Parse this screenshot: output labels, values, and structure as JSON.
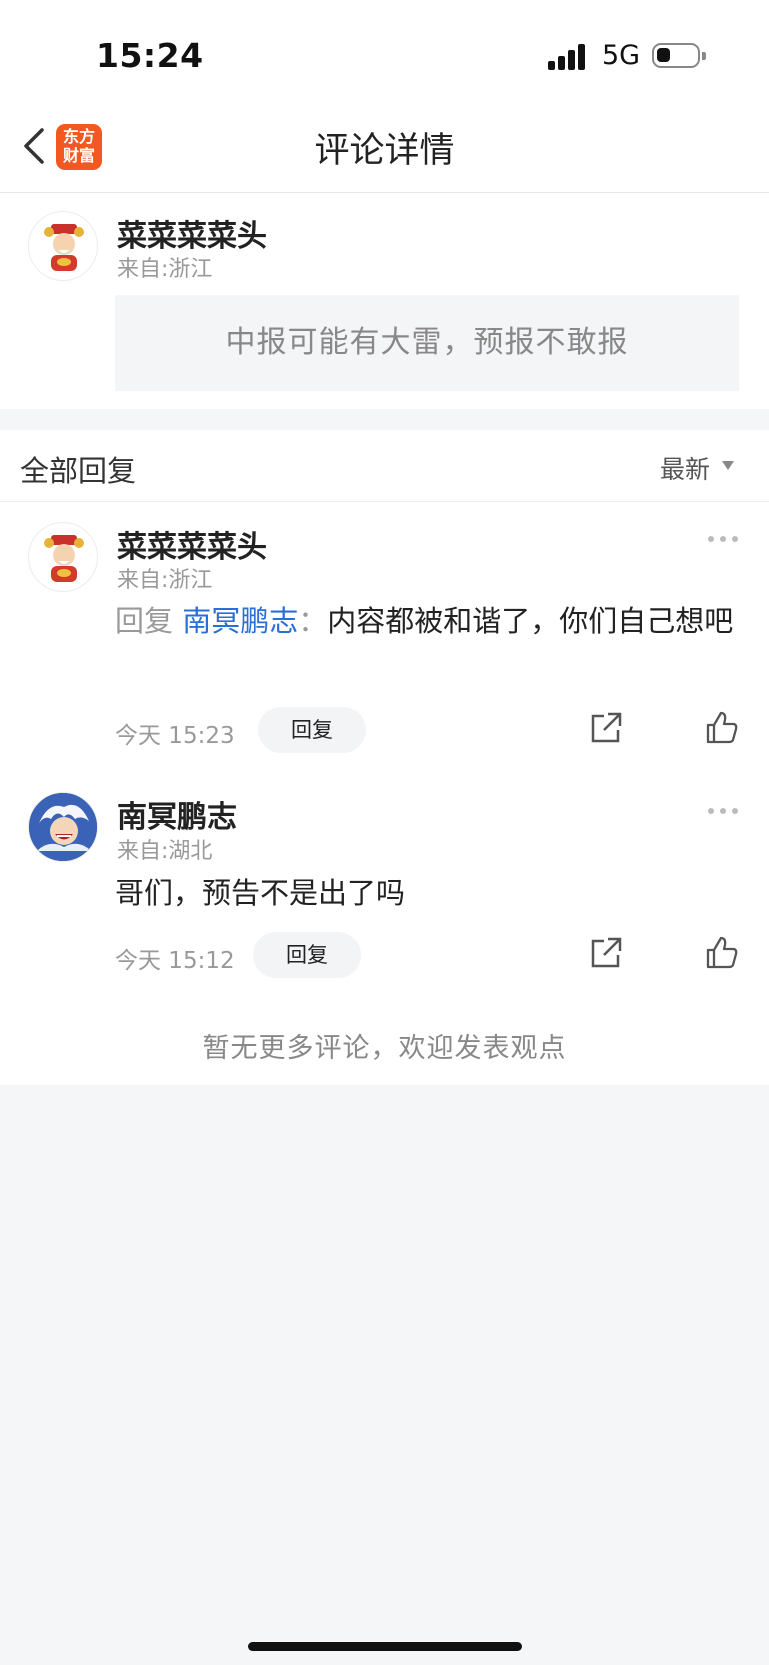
{
  "status_bar": {
    "time": "15:24",
    "network": "5G"
  },
  "nav": {
    "title": "评论详情",
    "logo_line1": "东方",
    "logo_line2": "财富"
  },
  "original_comment": {
    "author": "菜菜菜菜头",
    "location": "来自:浙江",
    "content": "中报可能有大雷，预报不敢报"
  },
  "replies_section": {
    "title": "全部回复",
    "sort_label": "最新",
    "replies": [
      {
        "author": "菜菜菜菜头",
        "location": "来自:浙江",
        "reply_prefix": "回复",
        "reply_to": "南冥鹏志",
        "separator": "：",
        "content": "内容都被和谐了，你们自己想吧",
        "timestamp": "今天 15:23",
        "reply_button": "回复"
      },
      {
        "author": "南冥鹏志",
        "location": "来自:湖北",
        "content": "哥们，预告不是出了吗",
        "timestamp": "今天 15:12",
        "reply_button": "回复"
      }
    ],
    "footer_note": "暂无更多评论，欢迎发表观点"
  },
  "colors": {
    "brand": "#f2581f",
    "link": "#2a6fd6",
    "background": "#f5f6f8"
  },
  "icons": [
    "back-icon",
    "share-icon",
    "like-icon",
    "more-icon",
    "chevron-down-icon"
  ]
}
